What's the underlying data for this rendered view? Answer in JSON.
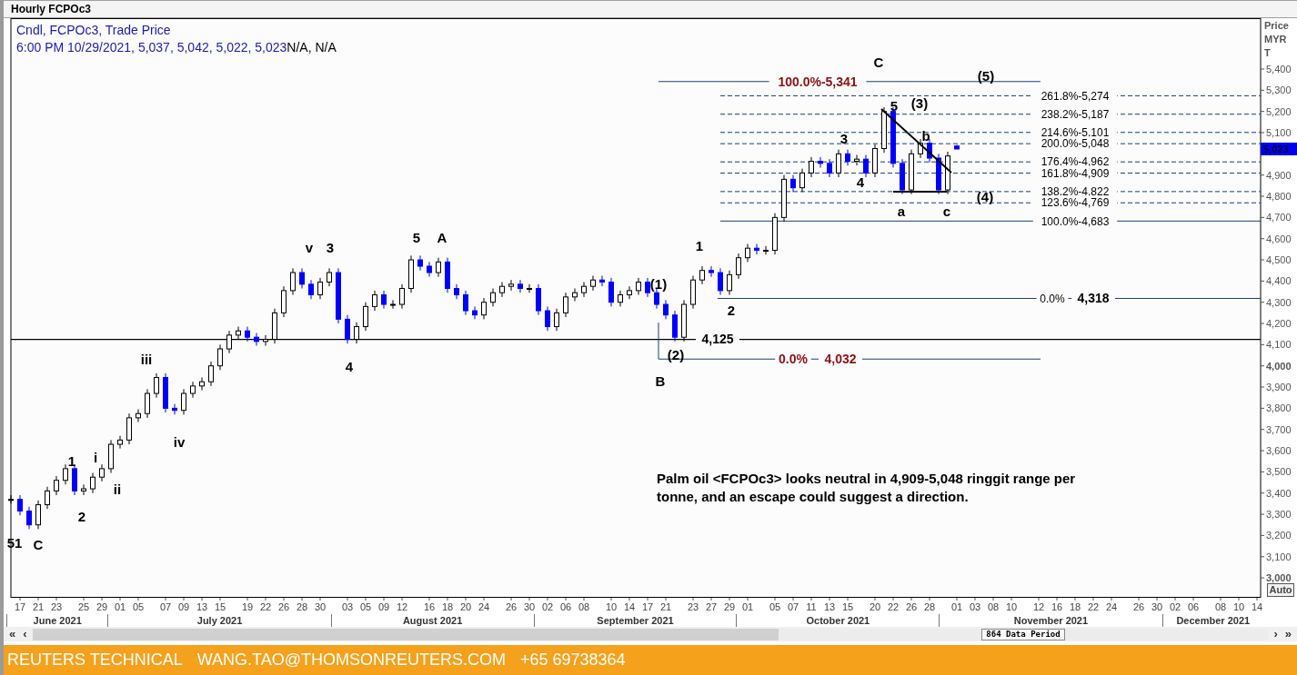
{
  "window": {
    "title": "Hourly FCPOc3"
  },
  "legend": {
    "series_text": "Cndl, FCPOc3, Trade Price",
    "ohlc_text": "6:00 PM 10/29/2021, 5,037, 5,042, 5,022, 5,023",
    "extra_text": "N/A, N/A"
  },
  "price_axis": {
    "header": [
      "Price",
      "MYR",
      "T"
    ],
    "last_price": "5,023",
    "auto_button": "Auto"
  },
  "chart": {
    "chart_data": {
      "type": "candlestick",
      "ylim": [
        2906,
        5640
      ],
      "categories": [
        null,
        "17",
        null,
        "21",
        null,
        "23",
        null,
        null,
        "25",
        null,
        "29",
        null,
        "01",
        null,
        "05",
        null,
        null,
        "07",
        null,
        "09",
        null,
        "13",
        null,
        "15",
        null,
        null,
        "19",
        null,
        "22",
        null,
        "26",
        null,
        "28",
        null,
        "30",
        null,
        null,
        "03",
        null,
        "05",
        null,
        "09",
        null,
        "12",
        null,
        null,
        "16",
        null,
        "18",
        null,
        "20",
        null,
        "24",
        null,
        null,
        "26",
        null,
        "30",
        null,
        "02",
        null,
        "06",
        null,
        "08",
        null,
        null,
        "10",
        null,
        "14",
        null,
        "17",
        null,
        "21",
        null,
        null,
        "23",
        null,
        "27",
        null,
        "29",
        null,
        "01",
        null,
        null,
        "05",
        null,
        "07",
        null,
        "11",
        null,
        "13",
        null,
        "15",
        null,
        null,
        "20",
        null,
        "22",
        null,
        "26",
        null,
        "28",
        null,
        null,
        "01",
        null,
        "03",
        null,
        "08",
        null,
        "10",
        null,
        null,
        "12",
        null,
        "16",
        null,
        "18",
        null,
        "22",
        null,
        "24",
        null,
        null,
        "26",
        null,
        "30",
        null,
        "02",
        null,
        "06",
        null,
        null,
        "08",
        null,
        "10",
        null,
        "14"
      ],
      "ohlc": [
        [
          3370,
          3390,
          3350,
          3370
        ],
        [
          3370,
          3390,
          3295,
          3315
        ],
        [
          3315,
          3335,
          3230,
          3250
        ],
        [
          3250,
          3365,
          3230,
          3345
        ],
        [
          3345,
          3430,
          3325,
          3410
        ],
        [
          3410,
          3480,
          3390,
          3460
        ],
        [
          3460,
          3535,
          3440,
          3515
        ],
        [
          3515,
          3535,
          3390,
          3410
        ],
        [
          3410,
          3440,
          3390,
          3420
        ],
        [
          3420,
          3495,
          3400,
          3475
        ],
        [
          3475,
          3535,
          3455,
          3515
        ],
        [
          3515,
          3650,
          3495,
          3630
        ],
        [
          3630,
          3670,
          3610,
          3650
        ],
        [
          3650,
          3775,
          3630,
          3755
        ],
        [
          3755,
          3795,
          3735,
          3775
        ],
        [
          3775,
          3890,
          3755,
          3870
        ],
        [
          3870,
          3965,
          3850,
          3945
        ],
        [
          3945,
          3965,
          3780,
          3800
        ],
        [
          3800,
          3820,
          3770,
          3790
        ],
        [
          3790,
          3890,
          3770,
          3870
        ],
        [
          3870,
          3925,
          3850,
          3905
        ],
        [
          3905,
          3945,
          3885,
          3925
        ],
        [
          3925,
          4020,
          3905,
          4000
        ],
        [
          4000,
          4100,
          3980,
          4080
        ],
        [
          4080,
          4165,
          4060,
          4145
        ],
        [
          4145,
          4185,
          4125,
          4165
        ],
        [
          4165,
          4185,
          4115,
          4135
        ],
        [
          4135,
          4155,
          4095,
          4115
        ],
        [
          4115,
          4145,
          4095,
          4125
        ],
        [
          4125,
          4270,
          4105,
          4250
        ],
        [
          4250,
          4375,
          4230,
          4355
        ],
        [
          4355,
          4460,
          4335,
          4440
        ],
        [
          4440,
          4460,
          4365,
          4385
        ],
        [
          4385,
          4405,
          4315,
          4335
        ],
        [
          4335,
          4415,
          4315,
          4395
        ],
        [
          4395,
          4460,
          4375,
          4440
        ],
        [
          4440,
          4460,
          4200,
          4220
        ],
        [
          4220,
          4240,
          4105,
          4125
        ],
        [
          4125,
          4205,
          4105,
          4185
        ],
        [
          4185,
          4300,
          4165,
          4280
        ],
        [
          4280,
          4355,
          4260,
          4335
        ],
        [
          4335,
          4355,
          4270,
          4290
        ],
        [
          4290,
          4310,
          4270,
          4290
        ],
        [
          4290,
          4385,
          4270,
          4365
        ],
        [
          4365,
          4520,
          4345,
          4500
        ],
        [
          4500,
          4520,
          4450,
          4470
        ],
        [
          4470,
          4490,
          4420,
          4440
        ],
        [
          4440,
          4510,
          4420,
          4490
        ],
        [
          4490,
          4510,
          4345,
          4365
        ],
        [
          4365,
          4385,
          4315,
          4335
        ],
        [
          4335,
          4355,
          4240,
          4260
        ],
        [
          4260,
          4280,
          4220,
          4240
        ],
        [
          4240,
          4320,
          4220,
          4300
        ],
        [
          4300,
          4365,
          4280,
          4345
        ],
        [
          4345,
          4395,
          4325,
          4375
        ],
        [
          4375,
          4405,
          4355,
          4385
        ],
        [
          4385,
          4405,
          4345,
          4365
        ],
        [
          4365,
          4385,
          4345,
          4365
        ],
        [
          4365,
          4385,
          4240,
          4260
        ],
        [
          4260,
          4280,
          4165,
          4185
        ],
        [
          4185,
          4270,
          4165,
          4250
        ],
        [
          4250,
          4345,
          4230,
          4325
        ],
        [
          4325,
          4365,
          4305,
          4345
        ],
        [
          4345,
          4395,
          4325,
          4375
        ],
        [
          4375,
          4425,
          4355,
          4405
        ],
        [
          4405,
          4425,
          4375,
          4395
        ],
        [
          4395,
          4415,
          4280,
          4300
        ],
        [
          4300,
          4355,
          4280,
          4335
        ],
        [
          4335,
          4375,
          4315,
          4355
        ],
        [
          4355,
          4415,
          4335,
          4395
        ],
        [
          4395,
          4415,
          4325,
          4345
        ],
        [
          4345,
          4365,
          4270,
          4290
        ],
        [
          4290,
          4310,
          4220,
          4240
        ],
        [
          4240,
          4260,
          4115,
          4135
        ],
        [
          4135,
          4310,
          4115,
          4290
        ],
        [
          4290,
          4425,
          4270,
          4405
        ],
        [
          4405,
          4470,
          4385,
          4450
        ],
        [
          4450,
          4470,
          4420,
          4440
        ],
        [
          4440,
          4460,
          4335,
          4355
        ],
        [
          4355,
          4450,
          4335,
          4430
        ],
        [
          4430,
          4530,
          4410,
          4510
        ],
        [
          4510,
          4575,
          4490,
          4555
        ],
        [
          4555,
          4575,
          4525,
          4545
        ],
        [
          4545,
          4565,
          4525,
          4545
        ],
        [
          4545,
          4720,
          4525,
          4700
        ],
        [
          4700,
          4900,
          4680,
          4880
        ],
        [
          4880,
          4900,
          4820,
          4840
        ],
        [
          4840,
          4930,
          4820,
          4910
        ],
        [
          4910,
          4985,
          4890,
          4965
        ],
        [
          4965,
          4985,
          4935,
          4955
        ],
        [
          4955,
          4975,
          4890,
          4910
        ],
        [
          4910,
          5020,
          4890,
          5000
        ],
        [
          5000,
          5020,
          4945,
          4965
        ],
        [
          4965,
          4995,
          4945,
          4975
        ],
        [
          4975,
          4995,
          4890,
          4910
        ],
        [
          4910,
          5045,
          4890,
          5025
        ],
        [
          5025,
          5220,
          5005,
          5200
        ],
        [
          5200,
          5220,
          4935,
          4955
        ],
        [
          4955,
          4975,
          4810,
          4830
        ],
        [
          4830,
          5020,
          4810,
          5000
        ],
        [
          5000,
          5070,
          4980,
          5050
        ],
        [
          5050,
          5070,
          4960,
          4980
        ],
        [
          4980,
          5000,
          4810,
          4830
        ],
        [
          4830,
          5010,
          4810,
          4990
        ],
        [
          5037,
          5042,
          5022,
          5023
        ],
        null,
        null,
        null,
        null,
        null,
        null,
        null,
        null,
        null,
        null,
        null,
        null,
        null,
        null,
        null,
        null,
        null,
        null,
        null,
        null,
        null,
        null,
        null,
        null,
        null,
        null,
        null,
        null,
        null,
        null,
        null,
        null,
        null
      ],
      "yticks": [
        {
          "value": 5400,
          "label": "5,400"
        },
        {
          "value": 5300,
          "label": "5,300"
        },
        {
          "value": 5200,
          "label": "5,200"
        },
        {
          "value": 5100,
          "label": "5,100"
        },
        {
          "value": 4900,
          "label": "4,900"
        },
        {
          "value": 4800,
          "label": "4,800"
        },
        {
          "value": 4700,
          "label": "4,700"
        },
        {
          "value": 4600,
          "label": "4,600"
        },
        {
          "value": 4500,
          "label": "4,500"
        },
        {
          "value": 4400,
          "label": "4,400"
        },
        {
          "value": 4300,
          "label": "4,300"
        },
        {
          "value": 4200,
          "label": "4,200"
        },
        {
          "value": 4100,
          "label": "4,100"
        },
        {
          "value": 4000,
          "label": "4,000"
        },
        {
          "value": 3900,
          "label": "3,900"
        },
        {
          "value": 3800,
          "label": "3,800"
        },
        {
          "value": 3700,
          "label": "3,700"
        },
        {
          "value": 3600,
          "label": "3,600"
        },
        {
          "value": 3500,
          "label": "3,500"
        },
        {
          "value": 3400,
          "label": "3,400"
        },
        {
          "value": 3300,
          "label": "3,300"
        },
        {
          "value": 3200,
          "label": "3,200"
        },
        {
          "value": 3100,
          "label": "3,100"
        },
        {
          "value": 3000,
          "label": "3,000"
        }
      ],
      "ref_lines": [
        {
          "axis": "y",
          "value": 5341
        },
        {
          "axis": "y",
          "value": 5274
        },
        {
          "axis": "y",
          "value": 5187
        },
        {
          "axis": "y",
          "value": 5101
        },
        {
          "axis": "y",
          "value": 5048
        },
        {
          "axis": "y",
          "value": 4962
        },
        {
          "axis": "y",
          "value": 4909
        },
        {
          "axis": "y",
          "value": 4822
        },
        {
          "axis": "y",
          "value": 4769
        },
        {
          "axis": "y",
          "value": 4683
        },
        {
          "axis": "y",
          "value": 4318
        },
        {
          "axis": "y",
          "value": 4125
        },
        {
          "axis": "y",
          "value": 4032
        }
      ],
      "annotations": [
        "51",
        "C",
        "1",
        "2",
        "i",
        "ii",
        "iii",
        "iv",
        "v",
        "3",
        "4",
        "5",
        "A",
        "(1)",
        "(2)",
        "B",
        "1",
        "2",
        "3",
        "4",
        "5",
        "(3)",
        "b",
        "a",
        "c",
        "(4)",
        "C",
        "(5)",
        "4,318",
        "4,032",
        "100.0%-5,341",
        "261.8%-5,274",
        "238.2%-5,187",
        "214.6%-5,101",
        "200.0%-5,048",
        "176.4%-4,962",
        "161.8%-4,909",
        "138.2%-4,822",
        "123.6%-4,769",
        "100.0%-4,683",
        "0.0%",
        "4,125",
        "0.0%"
      ]
    }
  },
  "note": {
    "text": "Palm oil <FCPOc3> looks neutral in 4,909-5,048 ringgit range per tonne, and an escape could suggest a direction."
  },
  "months": [
    "June 2021",
    "July 2021",
    "August 2021",
    "September 2021",
    "October 2021",
    "November 2021",
    "December 2021"
  ],
  "scrollbar": {
    "buttons_left": [
      "«",
      "‹"
    ],
    "label": "864 Data Period",
    "buttons_right": [
      "›",
      "»"
    ]
  },
  "footer": {
    "items": [
      "REUTERS TECHNICAL",
      "WANG.TAO@THOMSONREUTERS.COM",
      "+65 69738364"
    ]
  }
}
